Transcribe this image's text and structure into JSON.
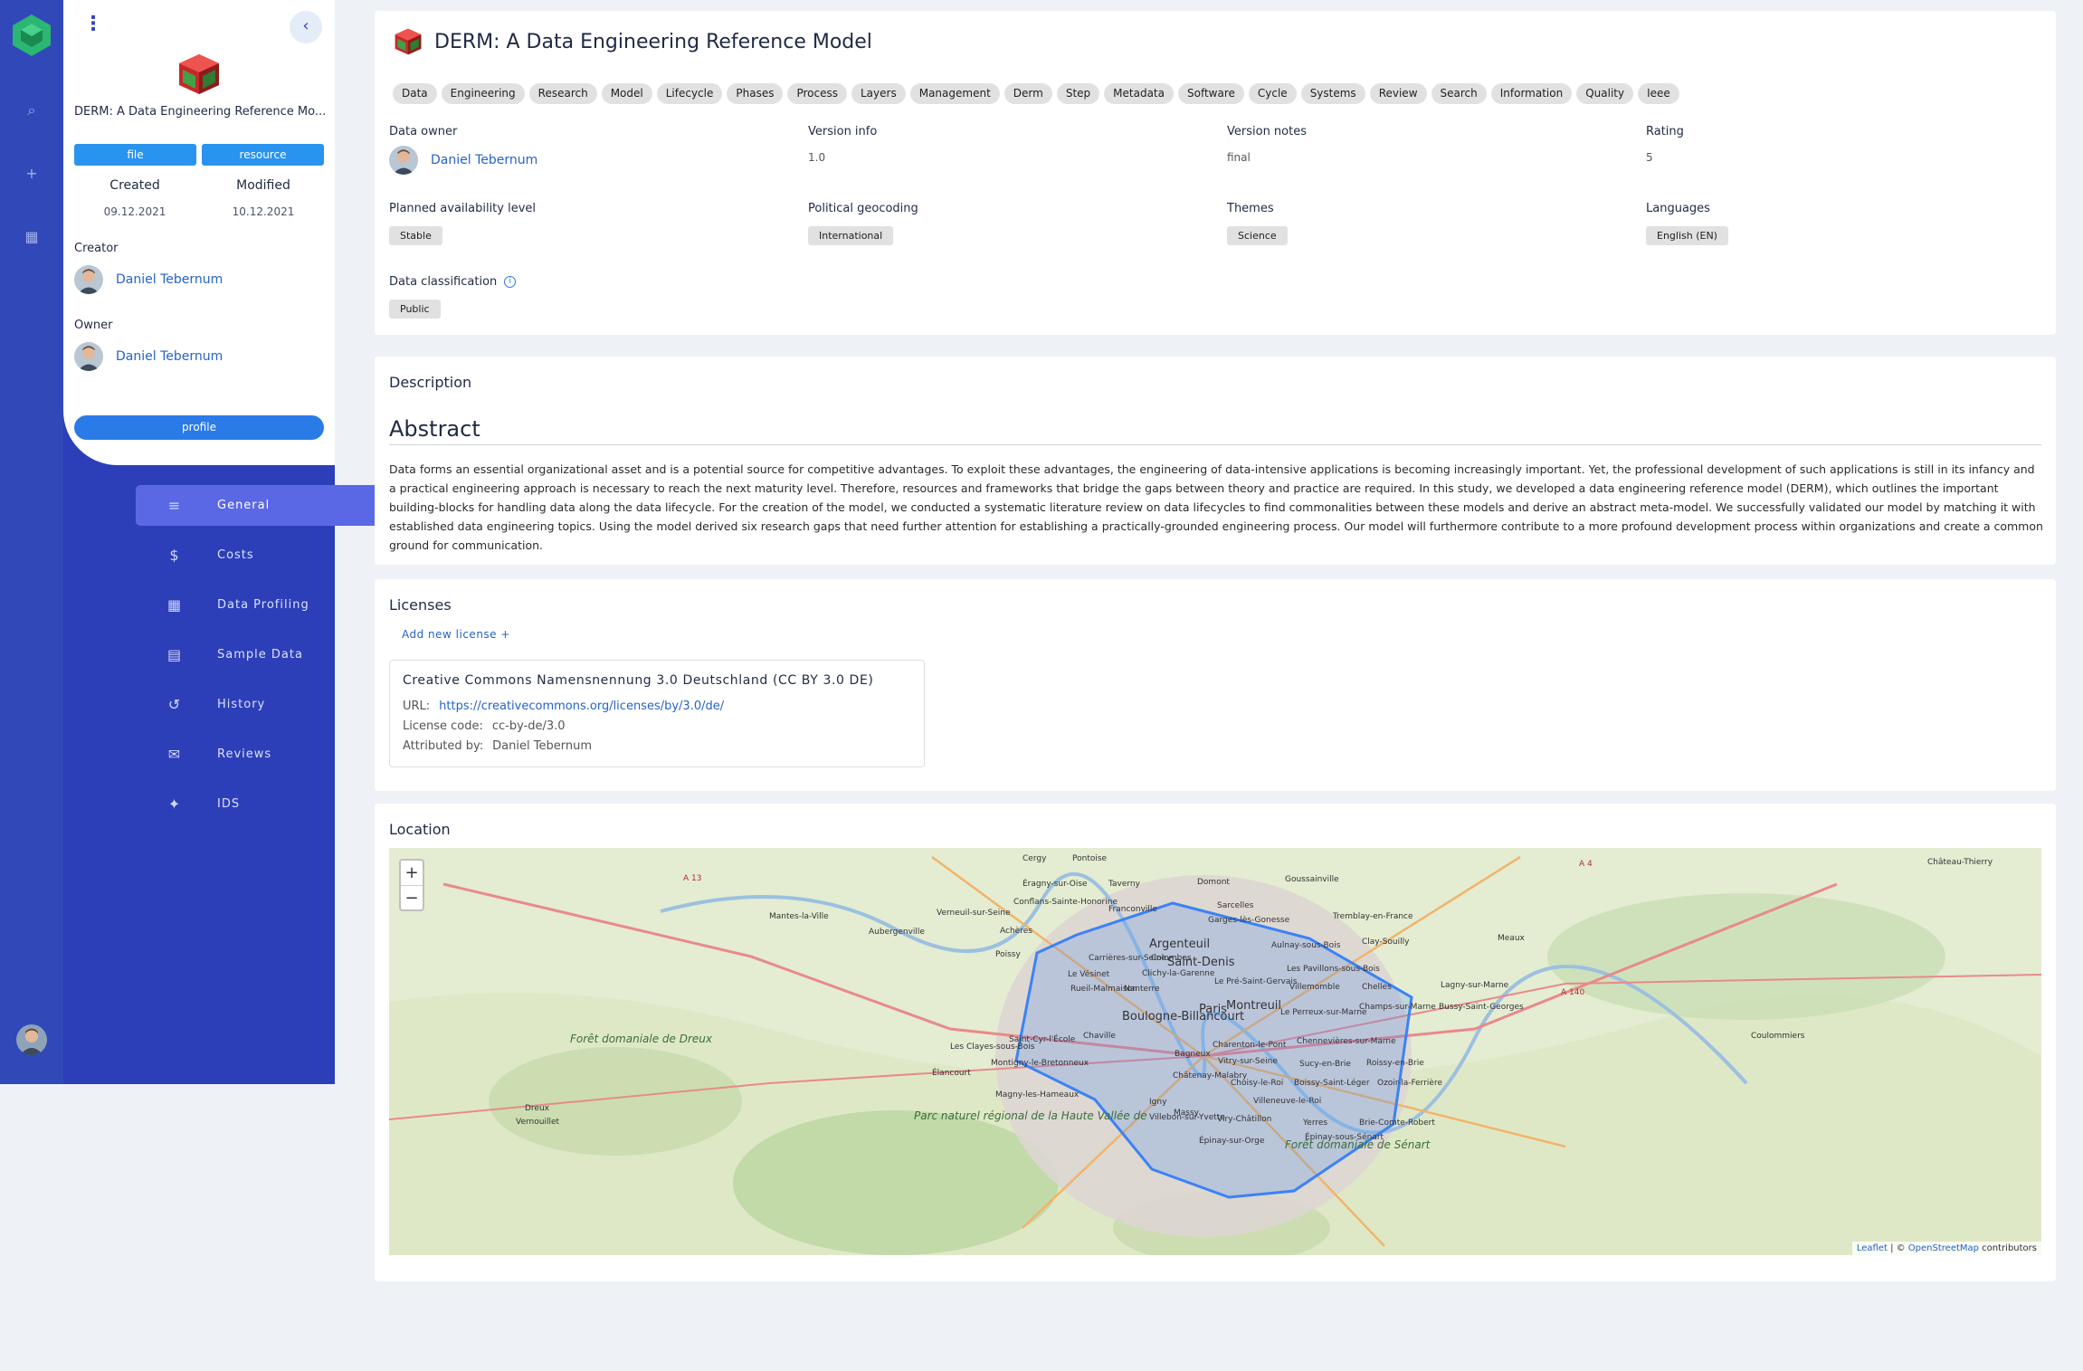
{
  "rail": {
    "icons": [
      "search-icon",
      "plus-icon",
      "dashboard-icon"
    ]
  },
  "sidebar": {
    "title": "DERM: A Data Engineering Reference Mo...",
    "file_label": "file",
    "resource_label": "resource",
    "created_label": "Created",
    "created_value": "09.12.2021",
    "modified_label": "Modified",
    "modified_value": "10.12.2021",
    "creator_label": "Creator",
    "creator_name": "Daniel Tebernum",
    "owner_label": "Owner",
    "owner_name": "Daniel Tebernum",
    "profile_label": "profile",
    "nav": [
      {
        "label": "General",
        "icon": "general-icon",
        "active": true
      },
      {
        "label": "Costs",
        "icon": "dollar-icon"
      },
      {
        "label": "Data Profiling",
        "icon": "table-icon"
      },
      {
        "label": "Sample Data",
        "icon": "document-icon"
      },
      {
        "label": "History",
        "icon": "history-icon"
      },
      {
        "label": "Reviews",
        "icon": "comments-icon"
      },
      {
        "label": "IDS",
        "icon": "ids-icon"
      }
    ]
  },
  "header": {
    "title": "DERM: A Data Engineering Reference Model",
    "tags": [
      "Data",
      "Engineering",
      "Research",
      "Model",
      "Lifecycle",
      "Phases",
      "Process",
      "Layers",
      "Management",
      "Derm",
      "Step",
      "Metadata",
      "Software",
      "Cycle",
      "Systems",
      "Review",
      "Search",
      "Information",
      "Quality",
      "Ieee"
    ]
  },
  "fields": {
    "data_owner_label": "Data owner",
    "data_owner_name": "Daniel Tebernum",
    "version_info_label": "Version info",
    "version_info_value": "1.0",
    "version_notes_label": "Version notes",
    "version_notes_value": "final",
    "rating_label": "Rating",
    "rating_value": "5",
    "availability_label": "Planned availability level",
    "availability_value": "Stable",
    "geocoding_label": "Political geocoding",
    "geocoding_value": "International",
    "themes_label": "Themes",
    "themes_value": "Science",
    "languages_label": "Languages",
    "languages_value": "English (EN)",
    "classification_label": "Data classification",
    "classification_value": "Public"
  },
  "description": {
    "heading": "Description",
    "abstract_heading": "Abstract",
    "abstract_text": "Data forms an essential organizational asset and is a potential source for competitive advantages. To exploit these advantages, the engineering of data-intensive applications is becoming increasingly important. Yet, the professional development of such applications is still in its infancy and a practical engineering approach is necessary to reach the next maturity level. Therefore, resources and frameworks that bridge the gaps between theory and practice are required. In this study, we developed a data engineering reference model (DERM), which outlines the important building-blocks for handling data along the data lifecycle. For the creation of the model, we conducted a systematic literature review on data lifecycles to find commonalities between these models and derive an abstract meta-model. We successfully validated our model by matching it with established data engineering topics. Using the model derived six research gaps that need further attention for establishing a practically-grounded engineering process. Our model will furthermore contribute to a more profound development process within organizations and create a common ground for communication."
  },
  "licenses": {
    "heading": "Licenses",
    "add_label": "Add new license +",
    "license_title": "Creative Commons Namensnennung 3.0 Deutschland (CC BY 3.0 DE)",
    "url_label": "URL:",
    "url_value": "https://creativecommons.org/licenses/by/3.0/de/",
    "code_label": "License code:",
    "code_value": "cc-by-de/3.0",
    "attributed_label": "Attributed by:",
    "attributed_value": "Daniel Tebernum"
  },
  "location": {
    "heading": "Location",
    "zoom_in": "+",
    "zoom_out": "−",
    "attribution_leaflet": "Leaflet",
    "attribution_sep": " | © ",
    "attribution_osm": "OpenStreetMap",
    "attribution_rest": " contributors",
    "places": [
      "Cergy",
      "Pontoise",
      "Taverny",
      "Domont",
      "Goussainville",
      "Sarcelles",
      "Tremblay-en-France",
      "Mantes-la-Ville",
      "Aubergenville",
      "Verneuil-sur-Seine",
      "Éragny-sur-Oise",
      "Conflans-Sainte-Honorine",
      "Franconville",
      "Argenteuil",
      "Saint-Denis",
      "Garges-lès-Gonesse",
      "Aulnay-sous-Bois",
      "Clay-Souilly",
      "Meaux",
      "Château-Thierry",
      "Achères",
      "Poissy",
      "Carrières-sur-Seine",
      "Colombes",
      "Clichy-la-Garenne",
      "Le Pré-Saint-Gervais",
      "Les Pavillons-sous-Bois",
      "Villemomble",
      "Chelles",
      "Lagny-sur-Marne",
      "Rueil-Malmaison",
      "Le Vésinet",
      "Nanterre",
      "Paris",
      "Montreuil",
      "Champs-sur-Marne",
      "Bussy-Saint-Georges",
      "Boulogne-Billancourt",
      "Le Perreux-sur-Marne",
      "Les Clayes-sous-Bois",
      "Saint-Cyr-l'École",
      "Chaville",
      "Charenton-le-Pont",
      "Chennevières-sur-Marne",
      "Coulommiers",
      "Forêt domaniale de Dreux",
      "Montigny-le-Bretonneux",
      "Bagneux",
      "Vitry-sur-Seine",
      "Sucy-en-Brie",
      "Roissy-en-Brie",
      "Ozoir-la-Ferrière",
      "Élancourt",
      "Châtenay-Malabry",
      "Choisy-le-Roi",
      "Boissy-Saint-Léger",
      "Magny-les-Hameaux",
      "Igny",
      "Massy",
      "Villeneuve-le-Roi",
      "Dreux",
      "Vernouillet",
      "Villebon-sur-Yvette",
      "Viry-Châtillon",
      "Yerres",
      "Brie-Comte-Robert",
      "Épinay-sous-Sénart",
      "Forêt domaniale de Sénart",
      "Épinay-sur-Orge",
      "Parc naturel régional de la Haute Vallée de",
      "A 13",
      "A 4",
      "A 140"
    ]
  },
  "colors": {
    "rail": "#3148b9",
    "nav_bg": "#2d3fb8",
    "nav_active": "#5a68e6",
    "accent_blue": "#2a93f0",
    "link": "#2563c8",
    "polygon": "#3b82f6"
  }
}
